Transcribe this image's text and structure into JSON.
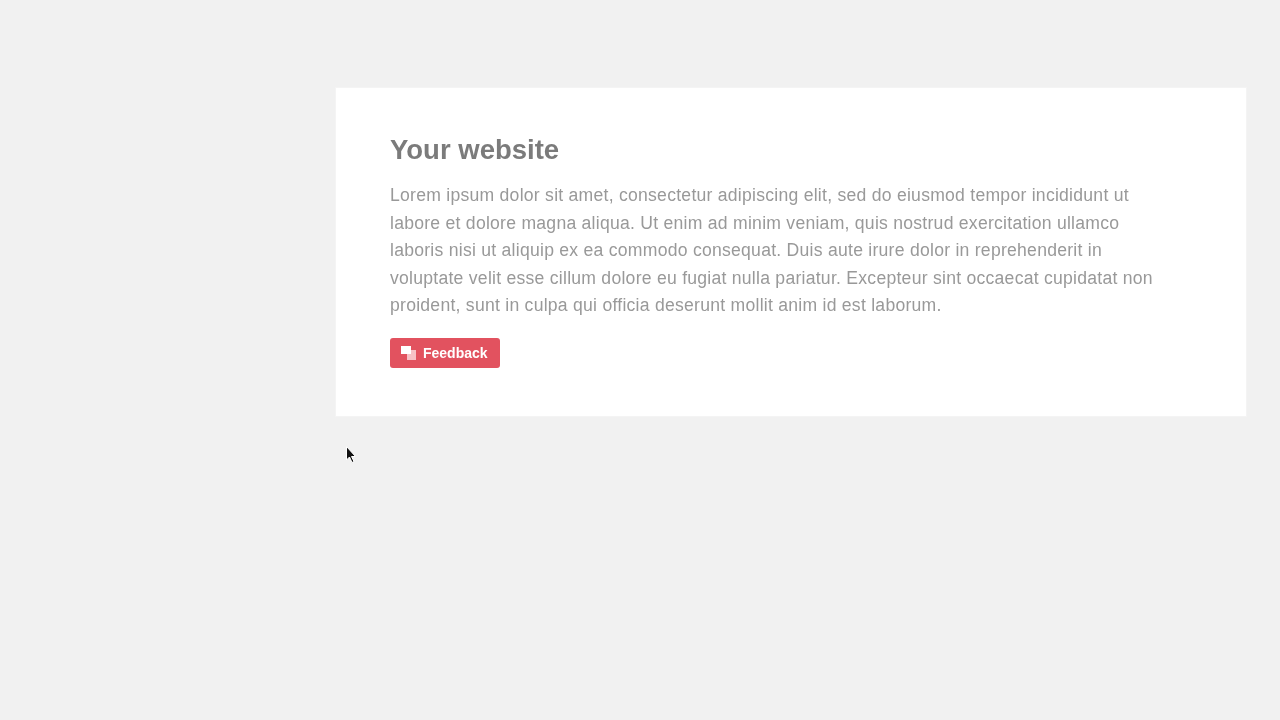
{
  "page": {
    "title": "Your website",
    "body": "Lorem ipsum dolor sit amet, consectetur adipiscing elit, sed do eiusmod tempor incididunt ut labore et dolore magna aliqua. Ut enim ad minim veniam, quis nostrud exercitation ullamco laboris nisi ut aliquip ex ea commodo consequat. Duis aute irure dolor in reprehenderit in voluptate velit esse cillum dolore eu fugiat nulla pariatur. Excepteur sint occaecat cupidatat non proident, sunt in culpa qui officia deserunt mollit anim id est laborum.",
    "button": {
      "label": "Feedback"
    }
  }
}
